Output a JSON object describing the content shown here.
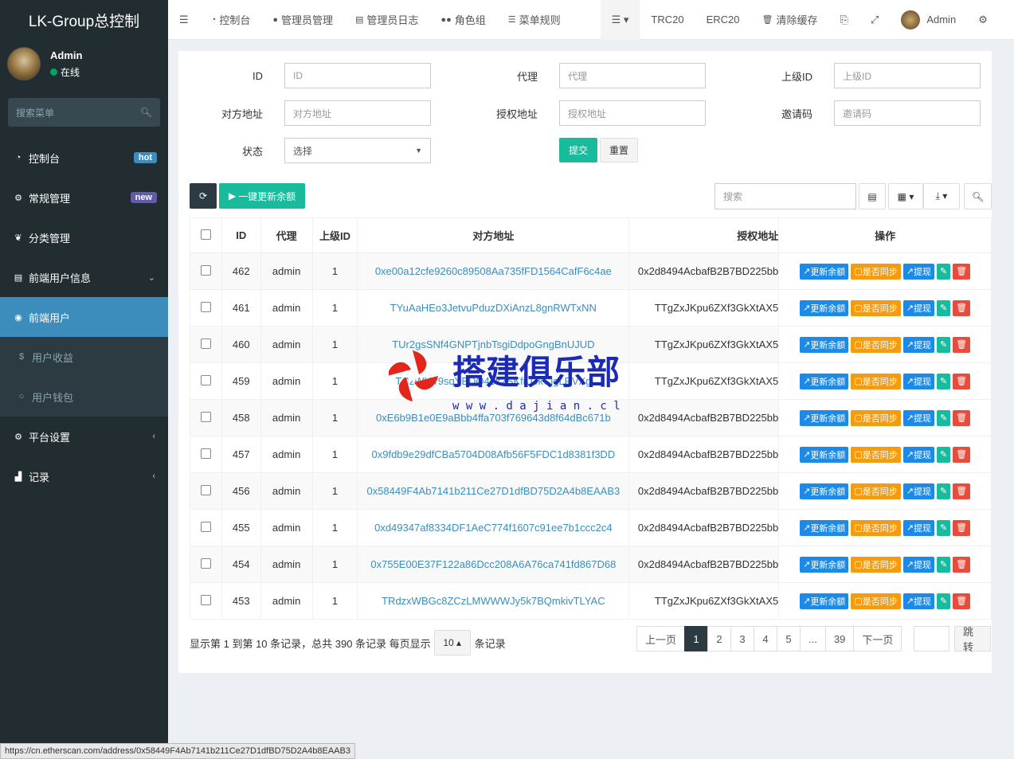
{
  "brand": "LK-Group总控制",
  "user": {
    "name": "Admin",
    "status": "在线"
  },
  "sidebar_search": "搜索菜单",
  "menu": [
    {
      "label": "控制台",
      "icon": "dashboard-icon",
      "badge": "hot",
      "badge_color": "#3c8dbc"
    },
    {
      "label": "常规管理",
      "icon": "cogs-icon",
      "badge": "new",
      "badge_color": "#605ca8"
    },
    {
      "label": "分类管理",
      "icon": "leaf-icon"
    },
    {
      "label": "前端用户信息",
      "icon": "list-icon",
      "arrow": "⌄"
    },
    {
      "label": "前端用户",
      "icon": "user-circle-icon",
      "active": true
    },
    {
      "label": "用户收益",
      "icon": "dollar-icon",
      "sub": true
    },
    {
      "label": "用户钱包",
      "icon": "circle-icon",
      "sub": true
    },
    {
      "label": "平台设置",
      "icon": "cog-icon",
      "arrow": "‹"
    },
    {
      "label": "记录",
      "icon": "chart-icon",
      "arrow": "‹"
    }
  ],
  "topnav": {
    "items": [
      "控制台",
      "管理员管理",
      "管理员日志",
      "角色组",
      "菜单规则"
    ],
    "trc": "TRC20",
    "erc": "ERC20",
    "clear_cache": "清除缓存",
    "admin": "Admin"
  },
  "filters": {
    "id_label": "ID",
    "id_ph": "ID",
    "agent_label": "代理",
    "agent_ph": "代理",
    "parent_label": "上级ID",
    "parent_ph": "上级ID",
    "peer_label": "对方地址",
    "peer_ph": "对方地址",
    "auth_label": "授权地址",
    "auth_ph": "授权地址",
    "invite_label": "邀请码",
    "invite_ph": "邀请码",
    "status_label": "状态",
    "status_value": "选择",
    "submit": "提交",
    "reset": "重置"
  },
  "toolbar": {
    "update_all": "一键更新余额",
    "search_ph": "搜索"
  },
  "table": {
    "headers": [
      "ID",
      "代理",
      "上级ID",
      "对方地址",
      "授权地址",
      "操作"
    ],
    "op_labels": [
      "更新余额",
      "是否同步",
      "提现"
    ],
    "rows": [
      {
        "id": "462",
        "agent": "admin",
        "parent": "1",
        "peer": "0xe00a12cfe9260c89508Aa735fFD1564CafF6c4ae",
        "auth": "0x2d8494AcbafB2B7BD225bb"
      },
      {
        "id": "461",
        "agent": "admin",
        "parent": "1",
        "peer": "TYuAaHEo3JetvuPduzDXiAnzL8gnRWTxNN",
        "auth": "TTgZxJKpu6ZXf3GkXtAX5"
      },
      {
        "id": "460",
        "agent": "admin",
        "parent": "1",
        "peer": "TUr2gsSNf4GNPTjnbTsgiDdpoGngBnUJUD",
        "auth": "TTgZxJKpu6ZXf3GkXtAX5"
      },
      {
        "id": "459",
        "agent": "admin",
        "parent": "1",
        "peer": "TCzWHfr9sqYBDQ4ek2SKfiUJkCjgLRVXg",
        "auth": "TTgZxJKpu6ZXf3GkXtAX5"
      },
      {
        "id": "458",
        "agent": "admin",
        "parent": "1",
        "peer": "0xE6b9B1e0E9aBbb4ffa703f769643d8f64dBc671b",
        "auth": "0x2d8494AcbafB2B7BD225bb"
      },
      {
        "id": "457",
        "agent": "admin",
        "parent": "1",
        "peer": "0x9fdb9e29dfCBa5704D08Afb56F5FDC1d8381f3DD",
        "auth": "0x2d8494AcbafB2B7BD225bb"
      },
      {
        "id": "456",
        "agent": "admin",
        "parent": "1",
        "peer": "0x58449F4Ab7141b211Ce27D1dfBD75D2A4b8EAAB3",
        "auth": "0x2d8494AcbafB2B7BD225bb"
      },
      {
        "id": "455",
        "agent": "admin",
        "parent": "1",
        "peer": "0xd49347af8334DF1AeC774f1607c91ee7b1ccc2c4",
        "auth": "0x2d8494AcbafB2B7BD225bb"
      },
      {
        "id": "454",
        "agent": "admin",
        "parent": "1",
        "peer": "0x755E00E37F122a86Dcc208A6A76ca741fd867D68",
        "auth": "0x2d8494AcbafB2B7BD225bb"
      },
      {
        "id": "453",
        "agent": "admin",
        "parent": "1",
        "peer": "TRdzxWBGc8ZCzLMWWWJy5k7BQmkivTLYAC",
        "auth": "TTgZxJKpu6ZXf3GkXtAX5"
      }
    ]
  },
  "footer": {
    "info": "显示第 1 到第 10 条记录，总共 390 条记录 每页显示",
    "per_page": "10",
    "info_tail": "条记录",
    "prev": "上一页",
    "next": "下一页",
    "jump": "跳转",
    "pages": [
      "1",
      "2",
      "3",
      "4",
      "5",
      "...",
      "39"
    ]
  },
  "watermark": {
    "text": "搭建俱乐部",
    "url": "w w w . d a j i a n . c l u b"
  },
  "status_url": "https://cn.etherscan.com/address/0x58449F4Ab7141b211Ce27D1dfBD75D2A4b8EAAB3"
}
